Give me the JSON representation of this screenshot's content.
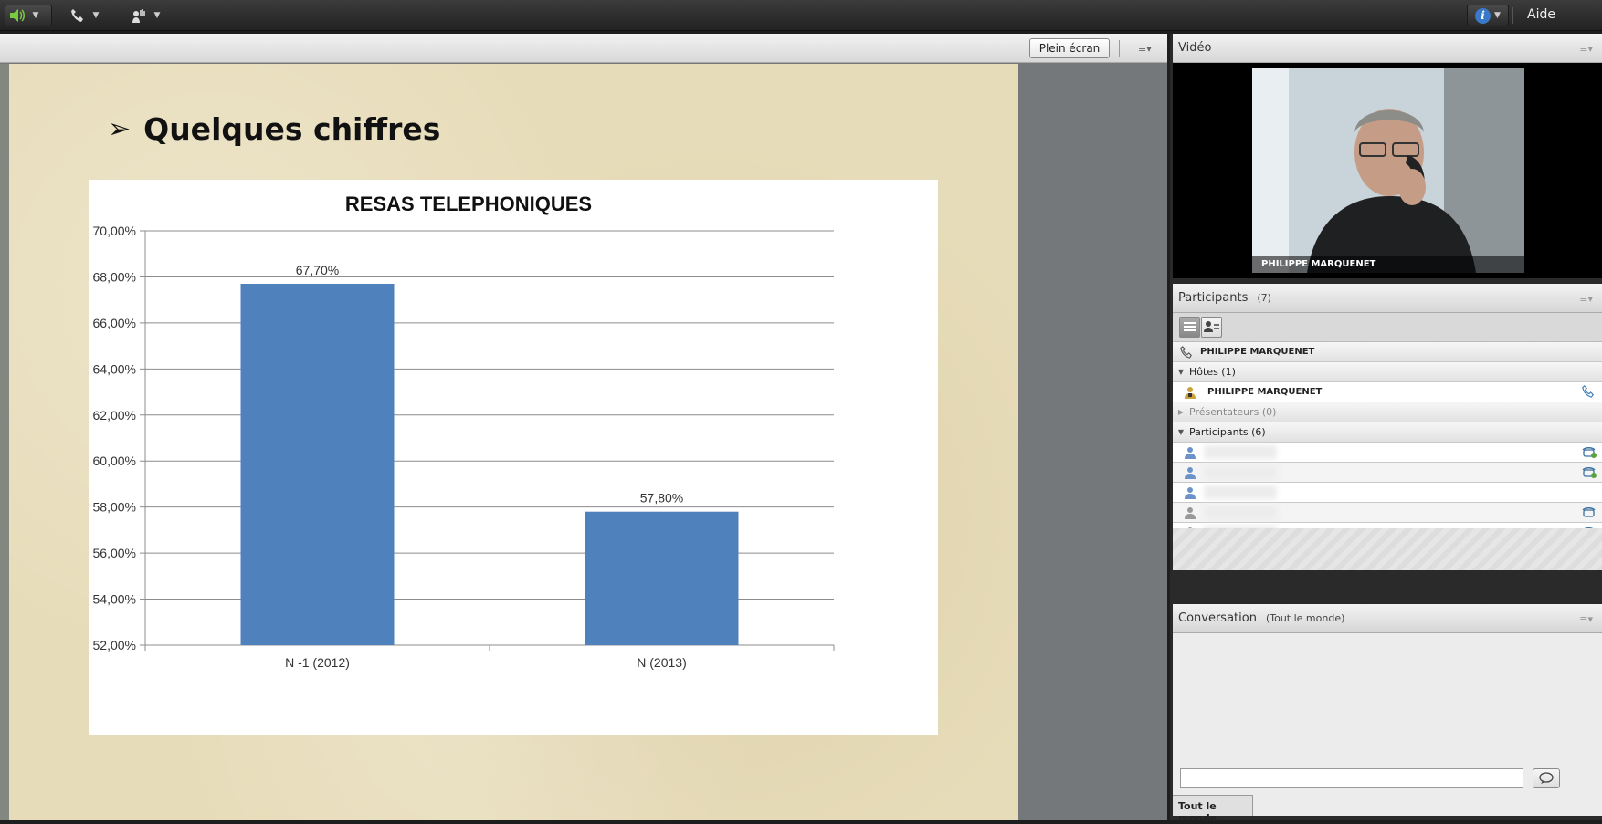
{
  "toolbar": {
    "audio_icon": "speaker-icon",
    "phone_icon": "phone-icon",
    "raise_hand_icon": "raise-hand-icon",
    "help_icon": "info-icon",
    "help_label": "Aide",
    "audio_color": "#7ac943"
  },
  "share": {
    "fullscreen_label": "Plein écran",
    "slide_title": "Quelques chiffres"
  },
  "chart_data": {
    "type": "bar",
    "title": "RESAS TELEPHONIQUES",
    "categories": [
      "N -1 (2012)",
      "N (2013)"
    ],
    "values": [
      67.7,
      57.8
    ],
    "value_labels": [
      "67,70%",
      "57,80%"
    ],
    "ylim": [
      52,
      70
    ],
    "yticks": [
      "52,00%",
      "54,00%",
      "56,00%",
      "58,00%",
      "60,00%",
      "62,00%",
      "64,00%",
      "66,00%",
      "68,00%",
      "70,00%"
    ],
    "ytick_values": [
      52,
      54,
      56,
      58,
      60,
      62,
      64,
      66,
      68,
      70
    ],
    "bar_color": "#4f81bd",
    "grid": true,
    "legend": "none"
  },
  "video": {
    "title": "Vidéo",
    "speaker_name": "PHILIPPE MARQUENET"
  },
  "participants": {
    "title": "Participants",
    "count": "(7)",
    "speaking": "PHILIPPE MARQUENET",
    "hosts_label": "Hôtes (1)",
    "host_name": "PHILIPPE MARQUENET",
    "presenters_label": "Présentateurs (0)",
    "participants_label": "Participants (6)",
    "attendee_count": 6
  },
  "conversation": {
    "title": "Conversation",
    "audience": "(Tout le monde)",
    "tab_label": "Tout le monde",
    "input_value": ""
  }
}
